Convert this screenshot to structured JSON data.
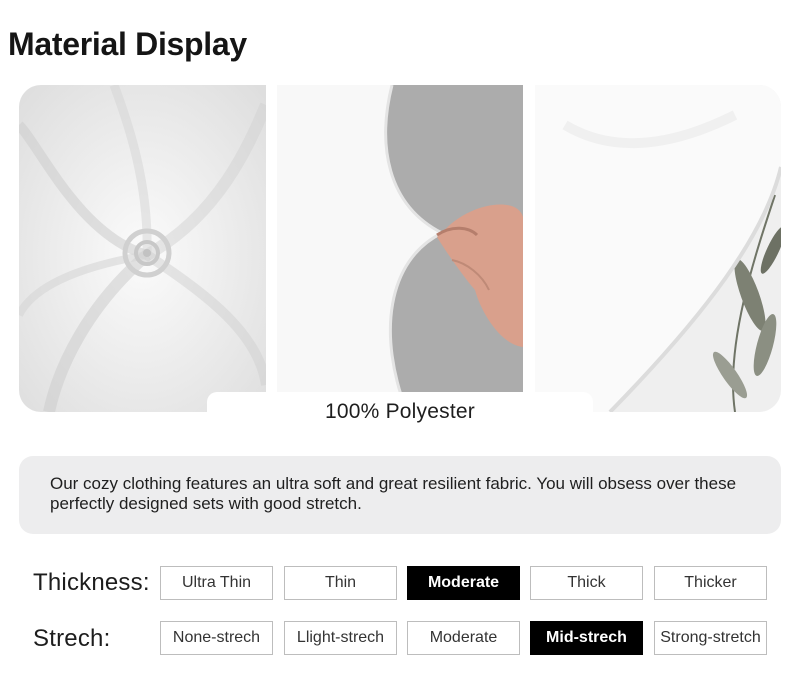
{
  "header": {
    "title": "Material Display"
  },
  "gallery": {
    "images": [
      {
        "alt": "swirled white fabric"
      },
      {
        "alt": "hand stretching white fabric"
      },
      {
        "alt": "fabric edge over leaf print"
      }
    ],
    "caption": "100% Polyester"
  },
  "description": "Our cozy clothing features an ultra soft and great resilient fabric. You will obsess over these perfectly designed sets with good stretch.",
  "specs": {
    "thickness": {
      "label": "Thickness:",
      "options": [
        "Ultra Thin",
        "Thin",
        "Moderate",
        "Thick",
        "Thicker"
      ],
      "selected_index": 2
    },
    "stretch": {
      "label": "Strech:",
      "options": [
        "None-strech",
        "Llight-strech",
        "Moderate",
        "Mid-strech",
        "Strong-stretch"
      ],
      "selected_index": 3
    }
  },
  "colors": {
    "selected_bg": "#000000",
    "box_bg": "#ededee",
    "border": "#bdbdbd"
  }
}
